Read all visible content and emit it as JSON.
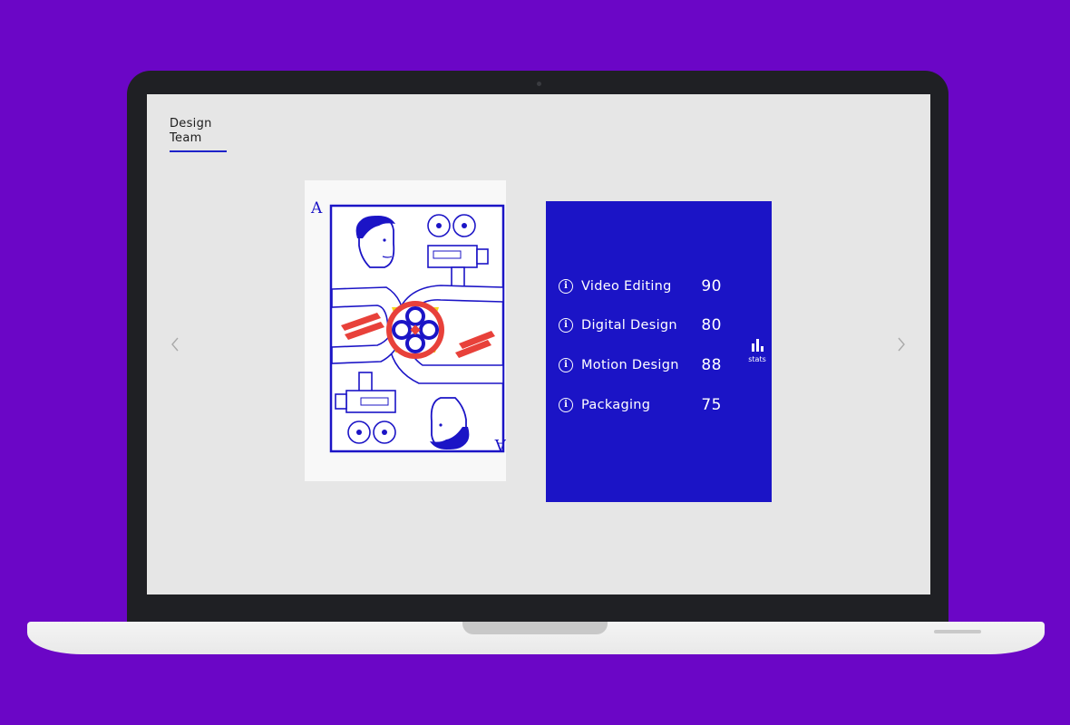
{
  "brand": {
    "line1": "Design",
    "line2": "Team"
  },
  "card": {
    "rank_top": "A",
    "rank_bottom": "A"
  },
  "stats": [
    {
      "label": "Video Editing",
      "value": "90"
    },
    {
      "label": "Digital Design",
      "value": "80"
    },
    {
      "label": "Motion Design",
      "value": "88"
    },
    {
      "label": "Packaging",
      "value": "75"
    }
  ],
  "stats_toggle": {
    "label": "stats",
    "icon": "bar-chart-icon"
  },
  "nav": {
    "prev_icon": "chevron-left-icon",
    "next_icon": "chevron-right-icon"
  },
  "colors": {
    "background": "#6b06c6",
    "accent_blue": "#1b14c6",
    "screen": "#e6e6e6",
    "card_red": "#e8413a",
    "card_yellow": "#f5d51f"
  }
}
